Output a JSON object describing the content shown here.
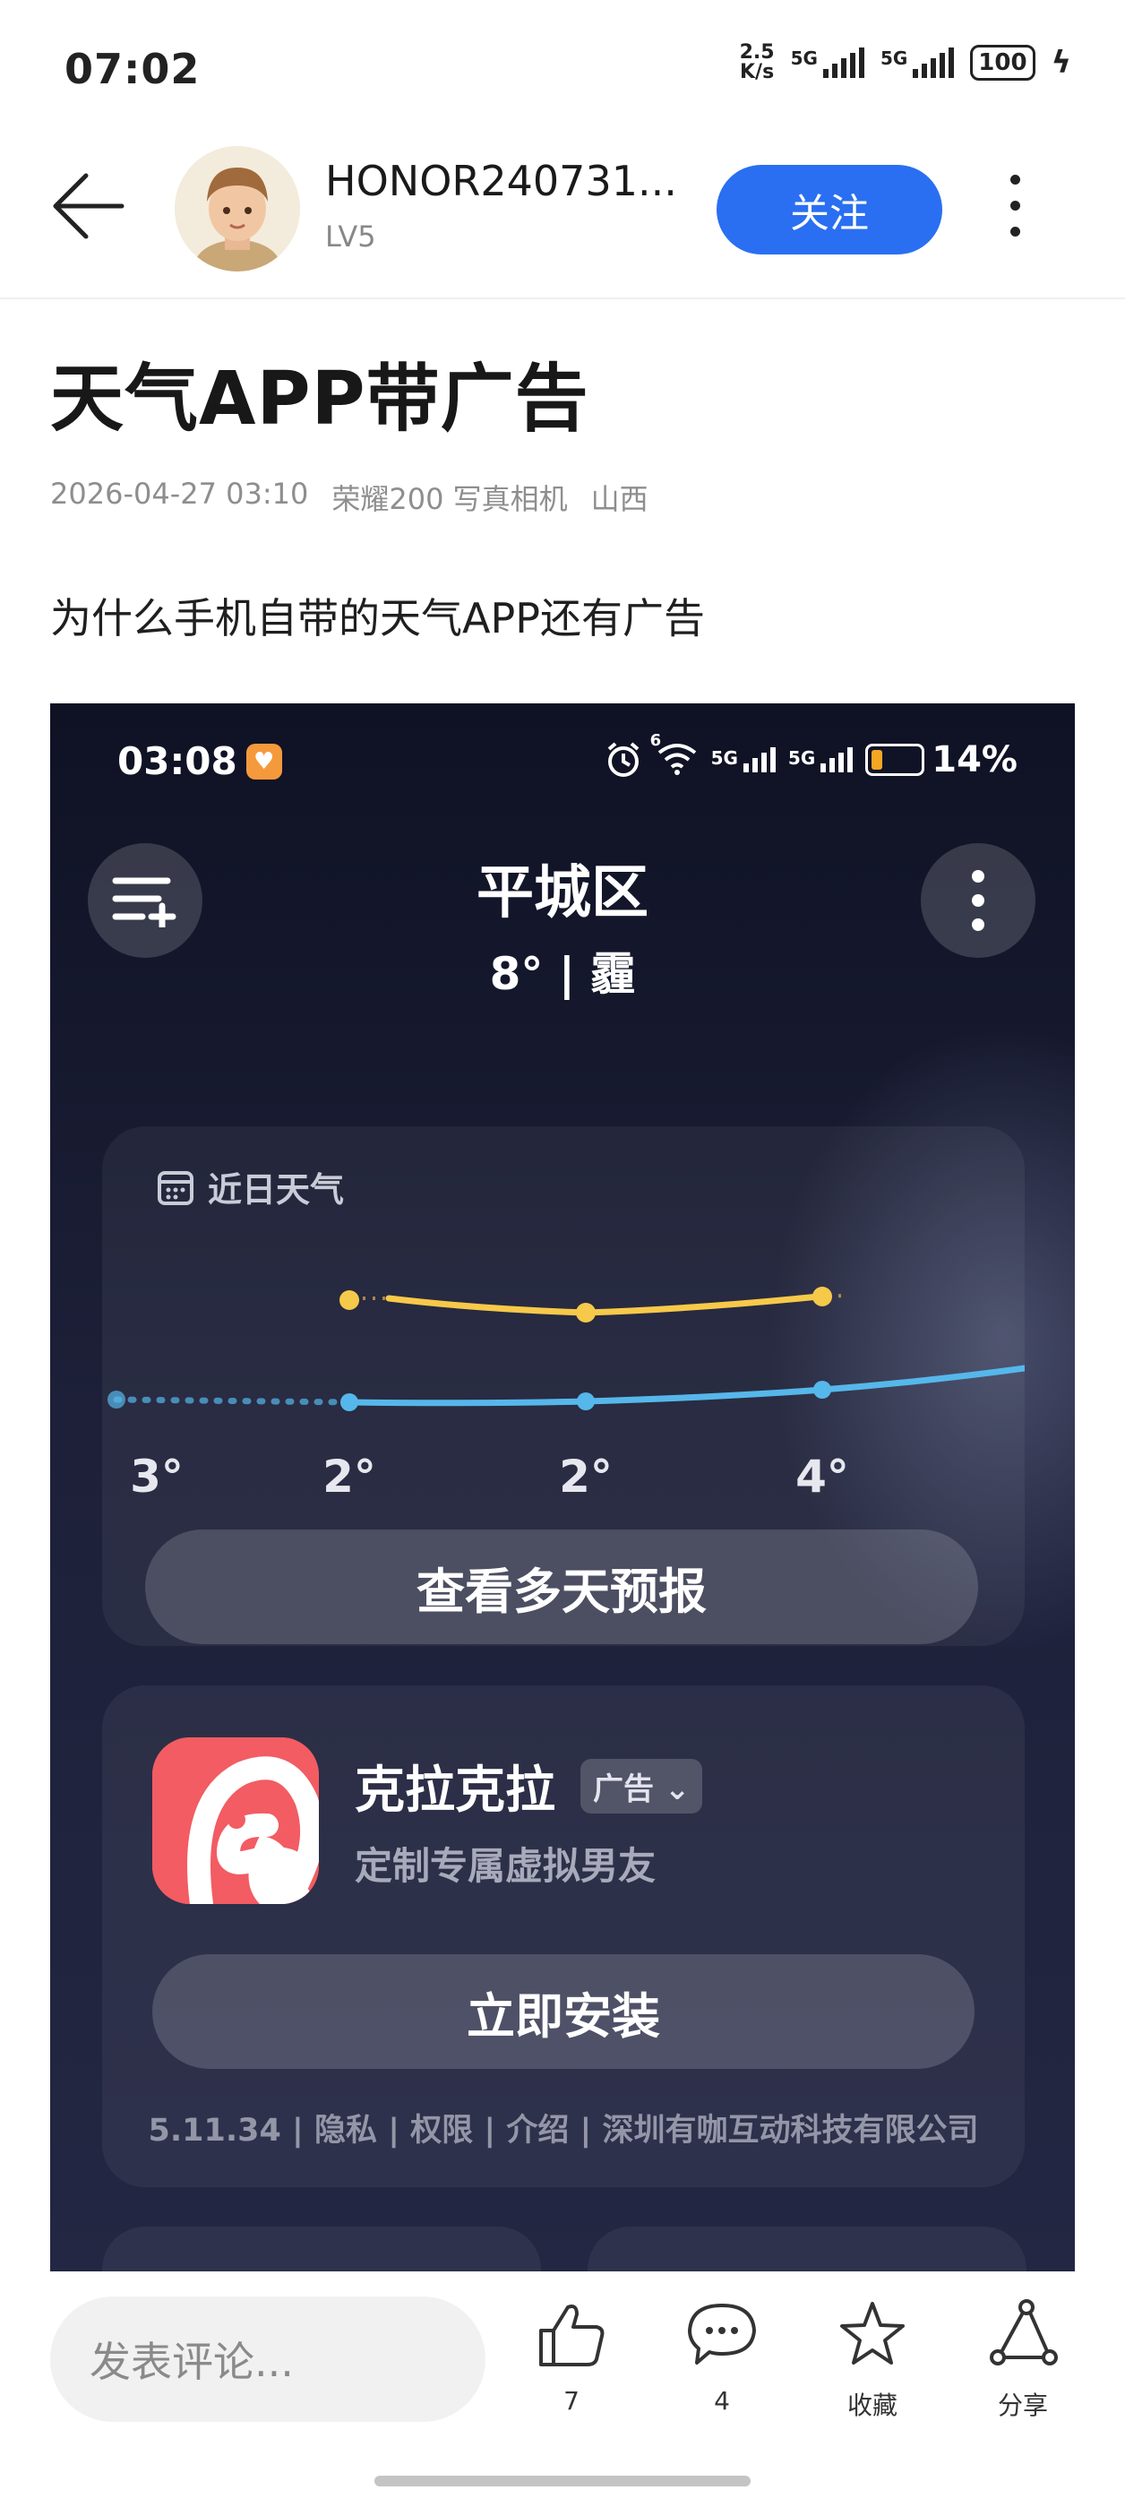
{
  "status_bar": {
    "time": "07:02",
    "net_speed_value": "2.5",
    "net_speed_unit": "K/s",
    "sim1": "5G",
    "sim2": "5G",
    "battery": "100"
  },
  "header": {
    "username": "HONOR240731...",
    "level": "LV5",
    "follow_label": "关注"
  },
  "post": {
    "title": "天气APP带广告",
    "date": "2026-04-27 03:10",
    "device": "荣耀200 写真相机",
    "location": "山西",
    "body": "为什么手机自带的天气APP还有广告"
  },
  "screenshot": {
    "status_time": "03:08",
    "sim1": "5G",
    "sim2": "5G",
    "wifi_tag": "6",
    "battery_pct": "14%",
    "battery_level": 0.14,
    "city": "平城区",
    "condition": "8° | 霾",
    "recent_weather_label": "近日天气",
    "temps": [
      "3°",
      "2°",
      "2°",
      "4°"
    ],
    "forecast_button": "查看多天预报",
    "ad": {
      "app_name": "克拉克拉",
      "ad_tag": "广告",
      "description": "定制专属虚拟男友",
      "install_button": "立即安装",
      "info": "5.11.34 | 隐私 | 权限 | 介绍 | 深圳有咖互动科技有限公司"
    }
  },
  "bottom_bar": {
    "comment_placeholder": "发表评论...",
    "like_count": "7",
    "comment_count": "4",
    "favorite_label": "收藏",
    "share_label": "分享"
  },
  "colors": {
    "accent": "#2a6ff2",
    "high_temp_line": "#f7c94a",
    "low_temp_line": "#56b7ea",
    "ad_icon": "#f25c62"
  }
}
